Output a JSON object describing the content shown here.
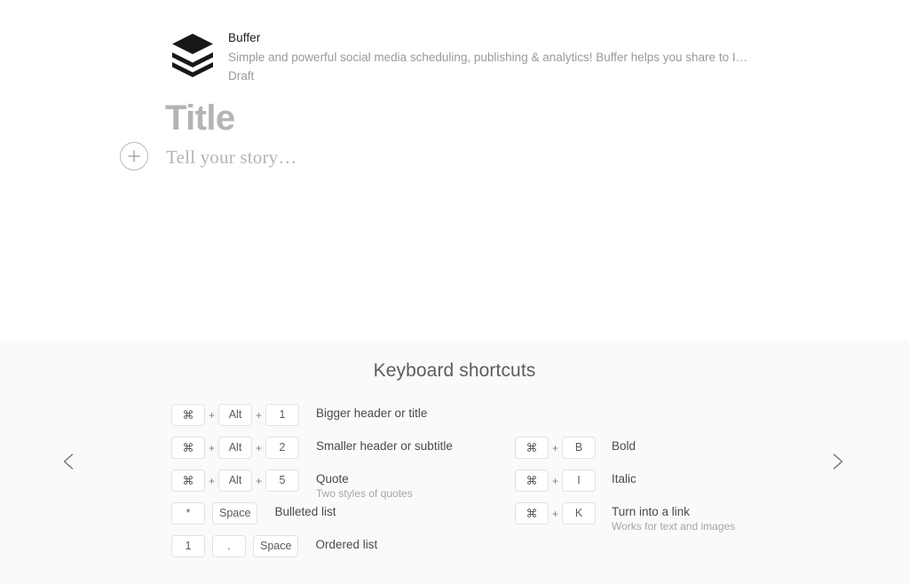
{
  "embed_card": {
    "logo_icon": "buffer-logo-icon",
    "title": "Buffer",
    "description": "Simple and powerful social media scheduling, publishing & analytics! Buffer helps you share to Insta…",
    "status": "Draft"
  },
  "editor": {
    "title_placeholder": "Title",
    "body_placeholder": "Tell your story…",
    "add_block_icon": "plus-circle-icon"
  },
  "shortcuts_panel": {
    "heading": "Keyboard shortcuts",
    "prev_icon": "chevron-left-icon",
    "next_icon": "chevron-right-icon",
    "columns": [
      {
        "name": "left",
        "rows": [
          {
            "keys": [
              {
                "type": "key",
                "label": "⌘"
              },
              {
                "type": "sep",
                "label": "+"
              },
              {
                "type": "key",
                "label": "Alt"
              },
              {
                "type": "sep",
                "label": "+"
              },
              {
                "type": "key",
                "label": "1"
              }
            ],
            "label": "Bigger header or title",
            "sublabel": ""
          },
          {
            "keys": [
              {
                "type": "key",
                "label": "⌘"
              },
              {
                "type": "sep",
                "label": "+"
              },
              {
                "type": "key",
                "label": "Alt"
              },
              {
                "type": "sep",
                "label": "+"
              },
              {
                "type": "key",
                "label": "2"
              }
            ],
            "label": "Smaller header or subtitle",
            "sublabel": ""
          },
          {
            "keys": [
              {
                "type": "key",
                "label": "⌘"
              },
              {
                "type": "sep",
                "label": "+"
              },
              {
                "type": "key",
                "label": "Alt"
              },
              {
                "type": "sep",
                "label": "+"
              },
              {
                "type": "key",
                "label": "5"
              }
            ],
            "label": "Quote",
            "sublabel": "Two styles of quotes"
          },
          {
            "keys": [
              {
                "type": "key",
                "label": "*"
              },
              {
                "type": "gap",
                "label": ""
              },
              {
                "type": "key",
                "label": "Space"
              }
            ],
            "label": "Bulleted list",
            "sublabel": ""
          },
          {
            "keys": [
              {
                "type": "key",
                "label": "1"
              },
              {
                "type": "gap",
                "label": ""
              },
              {
                "type": "key",
                "label": "."
              },
              {
                "type": "gap",
                "label": ""
              },
              {
                "type": "key",
                "label": "Space"
              }
            ],
            "label": "Ordered list",
            "sublabel": ""
          }
        ]
      },
      {
        "name": "right",
        "rows": [
          {
            "keys": [
              {
                "type": "key",
                "label": "⌘"
              },
              {
                "type": "sep",
                "label": "+"
              },
              {
                "type": "key",
                "label": "B"
              }
            ],
            "label": "Bold",
            "sublabel": ""
          },
          {
            "keys": [
              {
                "type": "key",
                "label": "⌘"
              },
              {
                "type": "sep",
                "label": "+"
              },
              {
                "type": "key",
                "label": "I"
              }
            ],
            "label": "Italic",
            "sublabel": ""
          },
          {
            "keys": [
              {
                "type": "key",
                "label": "⌘"
              },
              {
                "type": "sep",
                "label": "+"
              },
              {
                "type": "key",
                "label": "K"
              }
            ],
            "label": "Turn into a link",
            "sublabel": "Works for text and images"
          }
        ]
      }
    ]
  },
  "colors": {
    "canvas_background": "#ffffff",
    "panel_background": "#fafafa",
    "key_background": "#ffffff",
    "key_border": "#e2e2e2",
    "placeholder_text": "#b4b4b4",
    "label_text": "#4a4a4a",
    "muted_text": "#9a9a9a"
  }
}
